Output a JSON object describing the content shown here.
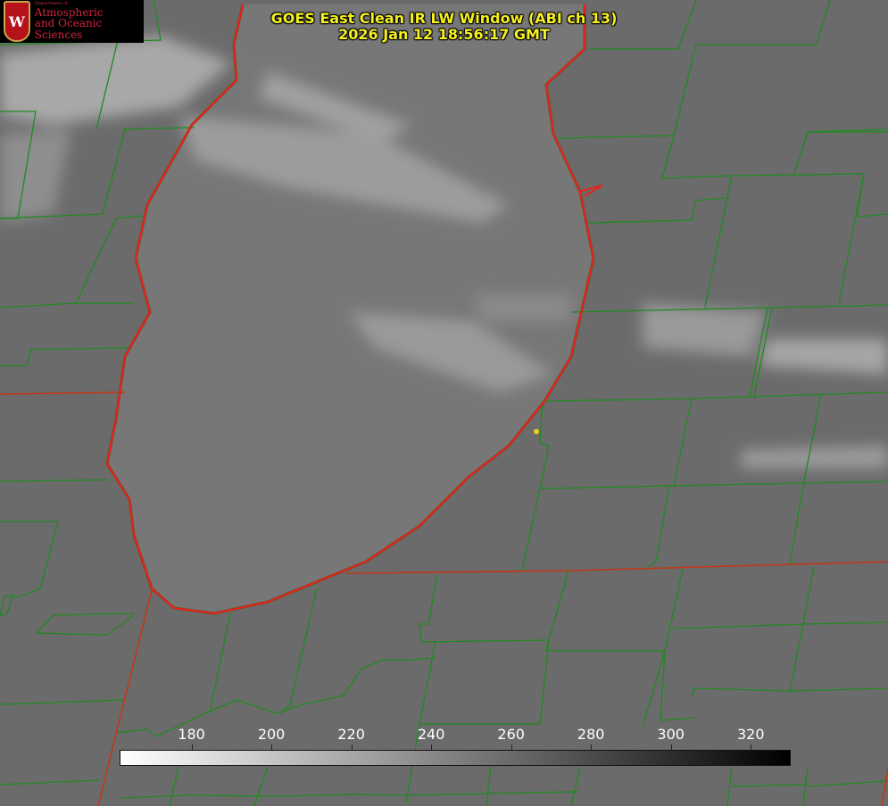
{
  "title": {
    "line1": "GOES East Clean IR LW Window (ABI ch 13)",
    "line2": "2026 Jan 12 18:56:17 GMT"
  },
  "logo": {
    "small": "Department of",
    "line1": "Atmospheric",
    "line2": "and Oceanic Sciences",
    "crest_letter": "W"
  },
  "colorbar": {
    "ticks": [
      "180",
      "200",
      "220",
      "240",
      "260",
      "280",
      "300",
      "320"
    ],
    "min_value": 162,
    "max_value": 330,
    "low_color": "#ffffff",
    "high_color": "#000000"
  },
  "colors": {
    "background": "#6b6b6b",
    "lake": "#787878",
    "shoreline": "#e8231f",
    "county_lines": "#1f8a1f",
    "state_lines": "#c0391a",
    "title": "#f5f021",
    "marker": "#e8d21f"
  }
}
